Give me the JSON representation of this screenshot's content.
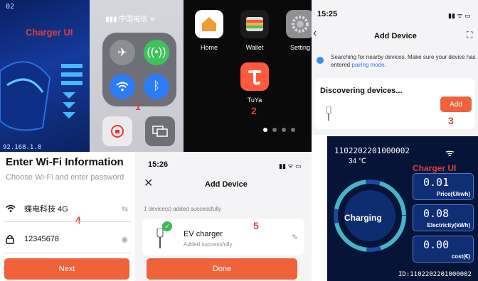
{
  "panel1": {
    "title": "Charger UI",
    "ip_top": "02",
    "ip_bottom": "92.168.1.8",
    "step": "1"
  },
  "panel2": {
    "carrier": "中国电信",
    "step": "1"
  },
  "panel3": {
    "apps": [
      {
        "label": "Home",
        "icon": "home-icon"
      },
      {
        "label": "Wallet",
        "icon": "wallet-icon"
      },
      {
        "label": "Setting",
        "icon": "settings-icon"
      }
    ],
    "tuya_label": "TuYa",
    "step": "2"
  },
  "panel4": {
    "time": "15:25",
    "title": "Add Device",
    "search_text": "Searching for nearby devices. Make sure your device has entered",
    "pairing_link": "pairing mode",
    "discovering": "Discovering devices...",
    "add_label": "Add",
    "step": "3",
    "accent": "#f0623a"
  },
  "panel5": {
    "title": "Enter Wi-Fi Information",
    "subtitle": "Choose Wi-Fi and enter password",
    "ssid": "蝶电科技 4G",
    "password": "12345678",
    "next_label": "Next",
    "step": "4"
  },
  "panel6": {
    "time": "15:26",
    "title": "Add Device",
    "added_count": "1 device(s) added successfully",
    "device_name": "EV charger",
    "device_status": "Added successfully",
    "done_label": "Done",
    "step": "5"
  },
  "panel7": {
    "id_top": "1102202201000002",
    "temp": "34 ℃",
    "overlay": "Charger UI",
    "status": "Charging",
    "price_value": "0.01",
    "price_label": "Price(€/kwh)",
    "elec_value": "0.08",
    "elec_label": "Electricity(kWh)",
    "cost_value": "0.00",
    "cost_label": "cost(€)",
    "id_bottom": "ID:1102202201000002"
  }
}
